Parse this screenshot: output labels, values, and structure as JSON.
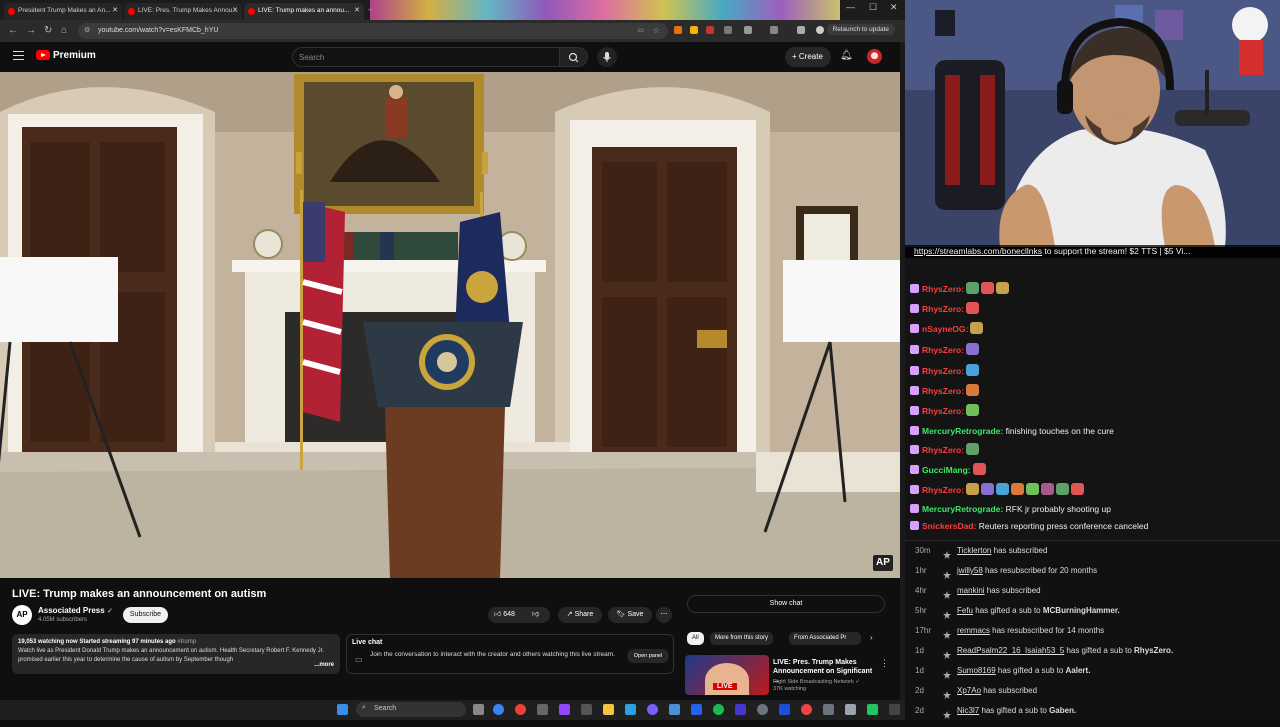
{
  "browser": {
    "tabs": [
      {
        "title": "President Trump Makes an An..."
      },
      {
        "title": "LIVE: Pres. Trump Makes Annou..."
      },
      {
        "title": "LIVE: Trump makes an annou..."
      }
    ],
    "url": "youtube.com/watch?v=esKFMCb_hYU",
    "relaunch_label": "Relaunch to update"
  },
  "youtube": {
    "brand": "Premium",
    "search_placeholder": "Search",
    "create_label": "Create",
    "video": {
      "title": "LIVE: Trump makes an announcement on autism",
      "watermark": "AP"
    },
    "channel": {
      "name": "Associated Press",
      "subscribers": "4.05M subscribers",
      "avatar_text": "AP",
      "subscribe_label": "Subscribe"
    },
    "actions": {
      "likes": "648",
      "share": "Share",
      "save": "Save"
    },
    "description": {
      "stats": "19,053 watching now  Started streaming 97 minutes ago",
      "hashtag": "#trump",
      "text": "Watch live as President Donald Trump makes an announcement on autism. Health Secretary Robert F. Kennedy Jr. promised earlier this year to determine the cause of autism by September though",
      "more": "...more"
    },
    "live_chat": {
      "label": "Live chat",
      "prompt": "Join the conversation to interact with the creator and others watching this live stream.",
      "open_panel": "Open panel"
    },
    "show_chat": "Show chat",
    "chips": [
      "All",
      "More from this story",
      "From Associated Pr"
    ],
    "recommendation": {
      "title": "LIVE: Pres. Trump Makes Announcement on Significant ...",
      "channel": "Right Side Broadcasting Network",
      "viewers": "37K watching",
      "badge": "LIVE"
    }
  },
  "taskbar": {
    "search_label": "Search"
  },
  "stream": {
    "ticker_link": "https://streamlabs.com/bonecllnks",
    "ticker_text": " to support the stream! $2 TTS | $5 Vi...",
    "chat": [
      {
        "user": "RhysZero:",
        "color": "#ff3c3c",
        "msg": "",
        "emotes": 3
      },
      {
        "user": "RhysZero:",
        "color": "#ff3c3c",
        "msg": "",
        "emotes": 1
      },
      {
        "user": "nSayneOG:",
        "color": "#ff3c3c",
        "msg": "",
        "emotes": 1
      },
      {
        "user": "RhysZero:",
        "color": "#ff3c3c",
        "msg": "",
        "emotes": 1
      },
      {
        "user": "RhysZero:",
        "color": "#ff3c3c",
        "msg": "",
        "emotes": 1
      },
      {
        "user": "RhysZero:",
        "color": "#ff3c3c",
        "msg": "",
        "emotes": 1
      },
      {
        "user": "RhysZero:",
        "color": "#ff3c3c",
        "msg": "",
        "emotes": 1
      },
      {
        "user": "MercuryRetrograde:",
        "color": "#3de868",
        "msg": " finishing touches on the cure",
        "emotes": 0
      },
      {
        "user": "RhysZero:",
        "color": "#ff3c3c",
        "msg": "",
        "emotes": 1
      },
      {
        "user": "GucciMang:",
        "color": "#3de868",
        "msg": "",
        "emotes": 1
      },
      {
        "user": "RhysZero:",
        "color": "#ff3c3c",
        "msg": "",
        "emotes": 8
      },
      {
        "user": "MercuryRetrograde:",
        "color": "#3de868",
        "msg": " RFK jr probably shooting up",
        "emotes": 0
      },
      {
        "user": "SnickersDad:",
        "color": "#ff3c3c",
        "msg": " Reuters reporting press conference canceled",
        "emotes": 0
      }
    ],
    "events": [
      {
        "time": "30m",
        "user": "Ticklerton",
        "rest": " has subscribed",
        "target": ""
      },
      {
        "time": "1hr",
        "user": "jwilly58",
        "rest": " has resubscribed for 20 months",
        "target": ""
      },
      {
        "time": "4hr",
        "user": "mankini",
        "rest": " has subscribed",
        "target": ""
      },
      {
        "time": "5hr",
        "user": "Fefu",
        "rest": " has gifted a sub to ",
        "target": "MCBurningHammer."
      },
      {
        "time": "17hr",
        "user": "remmacs",
        "rest": " has resubscribed for 14 months",
        "target": ""
      },
      {
        "time": "1d",
        "user": "ReadPsalm22_16_Isaiah53_5",
        "rest": " has gifted a sub to ",
        "target": "RhysZero."
      },
      {
        "time": "1d",
        "user": "Sumo8169",
        "rest": " has gifted a sub to ",
        "target": "Aalert."
      },
      {
        "time": "2d",
        "user": "Xp7Ao",
        "rest": " has subscribed",
        "target": ""
      },
      {
        "time": "2d",
        "user": "Nic3l7",
        "rest": " has gifted a sub to ",
        "target": "Gaben."
      }
    ]
  },
  "colors": {
    "yt_red": "#ff0000",
    "twitch_red": "#ff3c3c",
    "twitch_green": "#3de868"
  }
}
